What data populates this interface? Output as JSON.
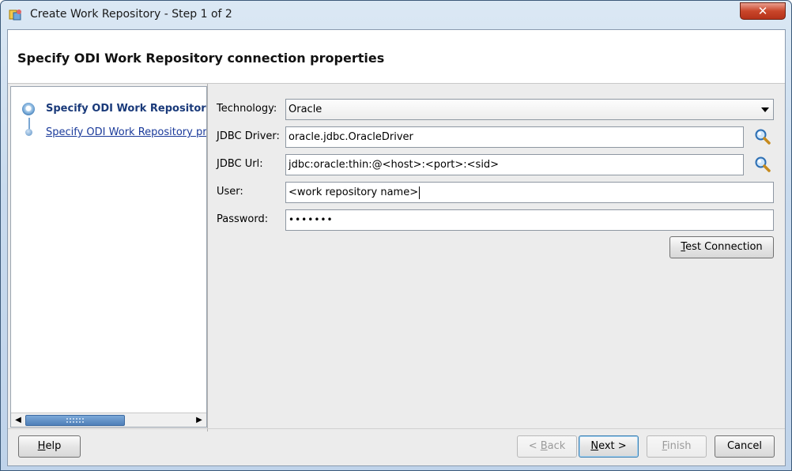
{
  "window": {
    "title": "Create Work Repository - Step 1 of 2",
    "close_glyph": "✕"
  },
  "header": {
    "title": "Specify ODI Work Repository connection properties"
  },
  "nav": {
    "items": [
      {
        "label": "Specify ODI Work Repository",
        "state": "current"
      },
      {
        "label": "Specify ODI Work Repository prop",
        "state": "next"
      }
    ],
    "scroll_left": "◀",
    "scroll_right": "▶",
    "scroll_position": 0.55
  },
  "form": {
    "technology": {
      "label": "Technology:",
      "value": "Oracle"
    },
    "jdbc_driver": {
      "label": "JDBC Driver:",
      "value": "oracle.jdbc.OracleDriver"
    },
    "jdbc_url": {
      "label": "JDBC Url:",
      "value": "jdbc:oracle:thin:@<host>:<port>:<sid>"
    },
    "user": {
      "label": "User:",
      "value": "<work repository name>"
    },
    "password": {
      "label": "Password:",
      "value": "•••••••"
    },
    "test_connection": {
      "mnemonic": "T",
      "rest": "est Connection"
    }
  },
  "footer": {
    "help": {
      "mnemonic": "H",
      "rest": "elp"
    },
    "back": {
      "pre": "< ",
      "mnemonic": "B",
      "rest": "ack",
      "enabled": false
    },
    "next": {
      "mnemonic": "N",
      "rest": "ext >",
      "enabled": true,
      "default": true
    },
    "finish": {
      "mnemonic": "F",
      "rest": "inish",
      "enabled": false
    },
    "cancel": {
      "label": "Cancel"
    }
  },
  "icons": {
    "title": "odi-app-icon",
    "search": "magnifier-icon"
  },
  "colors": {
    "nav_current_text": "#1a3a7a",
    "nav_link_text": "#1a3a9a",
    "close_button": "#c9462a"
  }
}
